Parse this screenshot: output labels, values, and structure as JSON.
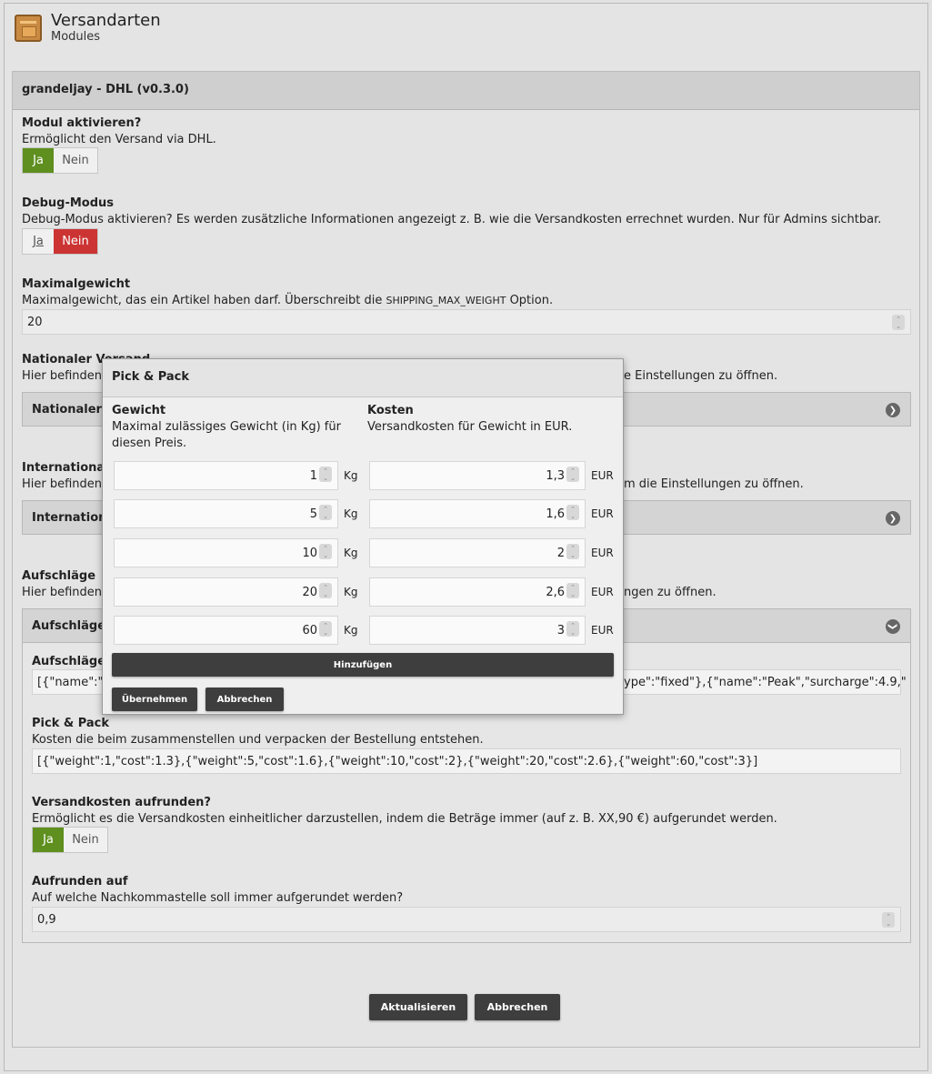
{
  "header": {
    "title": "Versandarten",
    "subtitle": "Modules"
  },
  "panel": {
    "title": "grandeljay - DHL (v0.3.0)"
  },
  "module": {
    "label": "Modul aktivieren?",
    "desc": "Ermöglicht den Versand via DHL.",
    "yes": "Ja",
    "no": "Nein",
    "selected": "Ja"
  },
  "debug": {
    "label": "Debug-Modus",
    "desc": "Debug-Modus aktivieren? Es werden zusätzliche Informationen angezeigt z. B. wie die Versandkosten errechnet wurden. Nur für Admins sichtbar.",
    "yes": "Ja",
    "no": "Nein",
    "selected": "Nein"
  },
  "maxweight": {
    "label": "Maximalgewicht",
    "desc_pre": "Maximalgewicht, das ein Artikel haben darf. Überschreibt die ",
    "desc_code": "SHIPPING_MAX_WEIGHT",
    "desc_post": " Option.",
    "value": "20"
  },
  "national": {
    "label": "Nationaler Versand",
    "desc_left": "Hier befinden",
    "desc_right": "e Einstellungen zu öffnen.",
    "acc": "Nationaler"
  },
  "international": {
    "label": "Internationaler",
    "desc_left": "Hier befinden",
    "desc_right": "m die Einstellungen zu öffnen.",
    "acc": "Internation"
  },
  "surcharges": {
    "label": "Aufschläge",
    "desc_left": "Hier befinden",
    "desc_right": "ngen zu öffnen.",
    "acc": "Aufschläge",
    "field_label": "Aufschläge",
    "field_left": "[{\"name\":\"",
    "field_right": "ype\":\"fixed\"},{\"name\":\"Peak\",\"surcharge\":4.9,\""
  },
  "pickpack": {
    "label": "Pick & Pack",
    "desc": "Kosten die beim zusammenstellen und verpacken der Bestellung entstehen.",
    "value": "[{\"weight\":1,\"cost\":1.3},{\"weight\":5,\"cost\":1.6},{\"weight\":10,\"cost\":2},{\"weight\":20,\"cost\":2.6},{\"weight\":60,\"cost\":3}]"
  },
  "roundup": {
    "label": "Versandkosten aufrunden?",
    "desc": "Ermöglicht es die Versandkosten einheitlicher darzustellen, indem die Beträge immer (auf z. B. XX,90 €) aufgerundet werden.",
    "yes": "Ja",
    "no": "Nein",
    "selected": "Ja"
  },
  "roundto": {
    "label": "Aufrunden auf",
    "desc": "Auf welche Nachkommastelle soll immer aufgerundet werden?",
    "value": "0,9"
  },
  "buttons": {
    "update": "Aktualisieren",
    "cancel": "Abbrechen"
  },
  "modal": {
    "title": "Pick & Pack",
    "col_weight": "Gewicht",
    "col_weight_desc1": "Maximal zulässiges Gewicht (in Kg) für",
    "col_weight_desc2": "diesen Preis.",
    "col_cost": "Kosten",
    "col_cost_desc": "Versandkosten für Gewicht in EUR.",
    "weight_unit": "Kg",
    "cost_unit": "EUR",
    "rows": [
      {
        "weight": "1",
        "cost": "1,3"
      },
      {
        "weight": "5",
        "cost": "1,6"
      },
      {
        "weight": "10",
        "cost": "2"
      },
      {
        "weight": "20",
        "cost": "2,6"
      },
      {
        "weight": "60",
        "cost": "3"
      }
    ],
    "add": "Hinzufügen",
    "apply": "Übernehmen",
    "cancel": "Abbrechen"
  }
}
